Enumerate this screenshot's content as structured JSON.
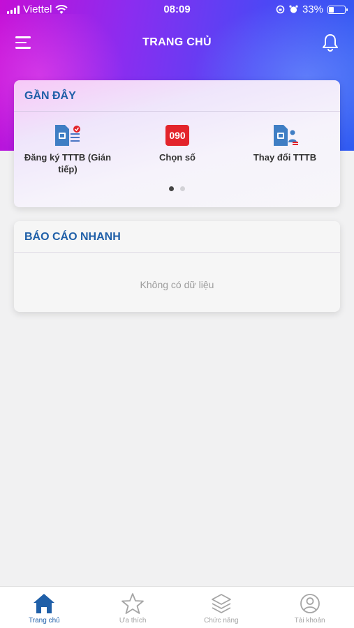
{
  "status_bar": {
    "carrier": "Viettel",
    "time": "08:09",
    "battery_percent": "33%",
    "battery_level": 0.33
  },
  "header": {
    "title": "TRANG CHỦ"
  },
  "recent": {
    "title": "GẦN ĐÂY",
    "items": [
      {
        "label": "Đăng ký TTTB (Gián tiếp)",
        "icon": "sim-register-icon"
      },
      {
        "label": "Chọn số",
        "icon": "number-select-icon",
        "badge": "090"
      },
      {
        "label": "Thay đổi TTTB",
        "icon": "sim-change-icon"
      }
    ],
    "page_count": 2,
    "active_page": 0
  },
  "report": {
    "title": "BÁO CÁO NHANH",
    "empty_text": "Không có dữ liệu"
  },
  "tabs": [
    {
      "label": "Trang chủ",
      "icon": "home-icon",
      "active": true
    },
    {
      "label": "Ưa thích",
      "icon": "star-icon",
      "active": false
    },
    {
      "label": "Chức năng",
      "icon": "layers-icon",
      "active": false
    },
    {
      "label": "Tài khoản",
      "icon": "account-icon",
      "active": false
    }
  ],
  "colors": {
    "accent": "#1f5fa8",
    "badge_red": "#e3242b",
    "tab_inactive": "#a5a5a5"
  }
}
